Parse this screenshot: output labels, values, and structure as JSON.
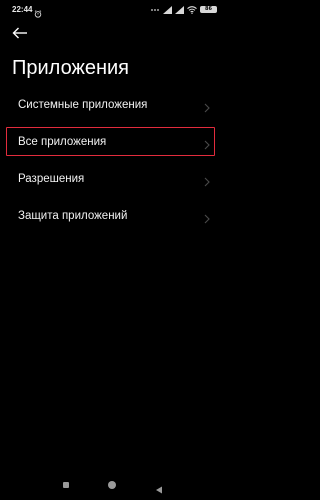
{
  "status_bar": {
    "time": "22:44",
    "battery_level": "86",
    "icons": [
      "alarm-icon",
      "dots-icon",
      "signal-icon",
      "signal-icon",
      "wifi-icon",
      "battery-icon"
    ]
  },
  "header": {
    "back_icon": "arrow-left-icon",
    "title": "Приложения"
  },
  "settings": {
    "items": [
      {
        "label": "Системные приложения",
        "highlighted": false
      },
      {
        "label": "Все приложения",
        "highlighted": true
      },
      {
        "label": "Разрешения",
        "highlighted": false
      },
      {
        "label": "Защита приложений",
        "highlighted": false
      }
    ]
  },
  "nav_bar": {
    "buttons": [
      "recent-apps",
      "home",
      "back"
    ]
  },
  "colors": {
    "background": "#000000",
    "text": "#f2f2f2",
    "chevron": "#4a4a4a",
    "highlight": "#e22c3d"
  }
}
